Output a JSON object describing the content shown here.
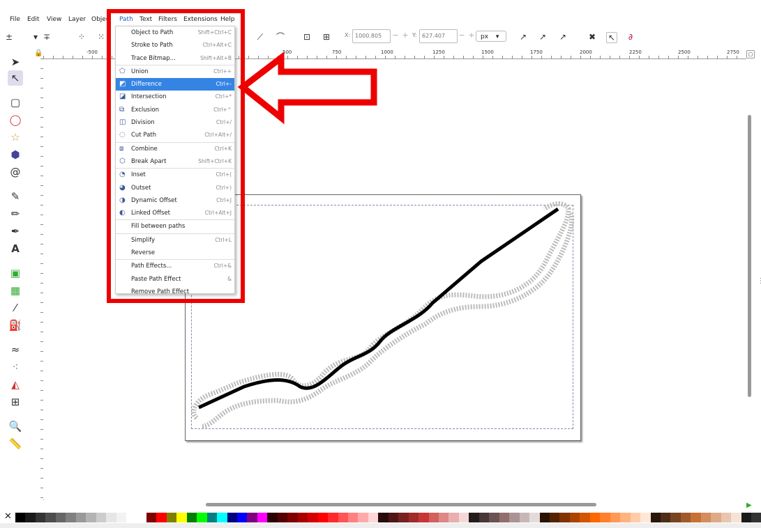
{
  "menubar": {
    "items": [
      "File",
      "Edit",
      "View",
      "Layer",
      "Objec",
      "Path",
      "Text",
      "Filters",
      "Extensions",
      "Help"
    ]
  },
  "toolbar": {
    "x_label": "X:",
    "x_value": "1000.805",
    "y_label": "Y:",
    "y_value": "627.407",
    "unit": "px"
  },
  "ruler": {
    "labels": [
      "-500",
      "500",
      "750",
      "1000",
      "1250",
      "1500",
      "1750",
      "2000",
      "2250",
      "2500",
      "2750"
    ]
  },
  "path_menu": {
    "items": [
      {
        "label": "Object to Path",
        "shortcut": "Shift+Ctrl+C",
        "icon": ""
      },
      {
        "label": "Stroke to Path",
        "shortcut": "Ctrl+Alt+C",
        "icon": ""
      },
      {
        "label": "Trace Bitmap...",
        "shortcut": "Shift+Alt+B",
        "icon": ""
      },
      {
        "label": "Union",
        "shortcut": "Ctrl++",
        "icon": "union-icon"
      },
      {
        "label": "Difference",
        "shortcut": "Ctrl+-",
        "icon": "difference-icon"
      },
      {
        "label": "Intersection",
        "shortcut": "Ctrl+*",
        "icon": "intersection-icon"
      },
      {
        "label": "Exclusion",
        "shortcut": "Ctrl+^",
        "icon": "exclusion-icon"
      },
      {
        "label": "Division",
        "shortcut": "Ctrl+/",
        "icon": "division-icon"
      },
      {
        "label": "Cut Path",
        "shortcut": "Ctrl+Alt+/",
        "icon": "cut-path-icon"
      },
      {
        "label": "Combine",
        "shortcut": "Ctrl+K",
        "icon": "combine-icon"
      },
      {
        "label": "Break Apart",
        "shortcut": "Shift+Ctrl+K",
        "icon": "break-apart-icon"
      },
      {
        "label": "Inset",
        "shortcut": "Ctrl+(",
        "icon": "inset-icon"
      },
      {
        "label": "Outset",
        "shortcut": "Ctrl+)",
        "icon": "outset-icon"
      },
      {
        "label": "Dynamic Offset",
        "shortcut": "Ctrl+J",
        "icon": "dynamic-offset-icon"
      },
      {
        "label": "Linked Offset",
        "shortcut": "Ctrl+Alt+J",
        "icon": "linked-offset-icon"
      },
      {
        "label": "Fill between paths",
        "shortcut": "",
        "icon": ""
      },
      {
        "label": "Simplify",
        "shortcut": "Ctrl+L",
        "icon": ""
      },
      {
        "label": "Reverse",
        "shortcut": "",
        "icon": ""
      },
      {
        "label": "Path Effects...",
        "shortcut": "Ctrl+&",
        "icon": ""
      },
      {
        "label": "Paste Path Effect",
        "shortcut": "&",
        "icon": ""
      },
      {
        "label": "Remove Path Effect",
        "shortcut": "",
        "icon": ""
      }
    ],
    "selected_index": 4,
    "separators_before": [
      3,
      9,
      11,
      15,
      16,
      18
    ]
  },
  "colors": {
    "highlight": "#3584e4",
    "annotation_red": "#ee0000"
  },
  "palette": [
    "#000000",
    "#1a1a1a",
    "#333333",
    "#4d4d4d",
    "#666666",
    "#808080",
    "#999999",
    "#b3b3b3",
    "#cccccc",
    "#e6e6e6",
    "#f2f2f2",
    "#ffffff",
    "#ffffff",
    "#800000",
    "#ff0000",
    "#808000",
    "#ffff00",
    "#008000",
    "#00ff00",
    "#008080",
    "#00ffff",
    "#000080",
    "#0000ff",
    "#800080",
    "#ff00ff",
    "#2b0000",
    "#550000",
    "#800000",
    "#aa0000",
    "#d40000",
    "#ff0000",
    "#ff2a2a",
    "#ff5555",
    "#ff8080",
    "#ffaaaa",
    "#ffd5d5",
    "#280b0b",
    "#501616",
    "#782121",
    "#a02c2c",
    "#c83737",
    "#d35f5f",
    "#de8787",
    "#e9afaf",
    "#f4d7d7",
    "#241c1c",
    "#483737",
    "#6c5353",
    "#916f6f",
    "#ac9393",
    "#c8b7b7",
    "#e3dbdb",
    "#2b1100",
    "#552200",
    "#803300",
    "#aa4400",
    "#d45500",
    "#ff6600",
    "#ff7f2a",
    "#ff9955",
    "#ffb380",
    "#ffccaa",
    "#ffe6d5",
    "#28170b",
    "#502d16",
    "#784421",
    "#a05a2c",
    "#c87137",
    "#d38d5f",
    "#deaa87",
    "#e9c6af",
    "#f4e3d7",
    "#1a1a1a",
    "#333333"
  ]
}
